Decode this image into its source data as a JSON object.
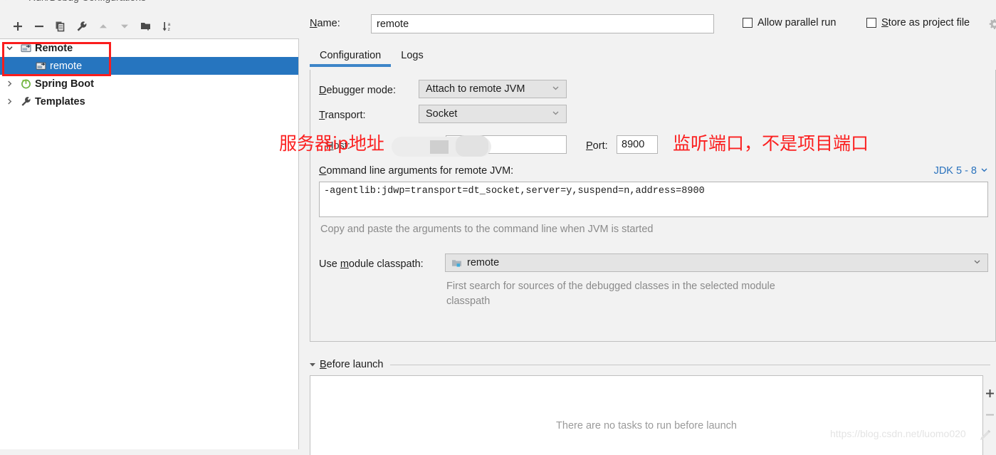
{
  "window": {
    "title_sliver": "Run/Debug Configurations"
  },
  "tree_toolbar": {
    "buttons": [
      {
        "name": "add-icon",
        "label": "Add New Configuration",
        "enabled": true
      },
      {
        "name": "remove-icon",
        "label": "Remove Configuration",
        "enabled": true
      },
      {
        "name": "copy-icon",
        "label": "Copy Configuration",
        "enabled": true
      },
      {
        "name": "wrench-icon",
        "label": "Edit Templates",
        "enabled": true
      },
      {
        "name": "arrow-up-icon",
        "label": "Move Up",
        "enabled": false
      },
      {
        "name": "arrow-down-icon",
        "label": "Move Down",
        "enabled": false
      },
      {
        "name": "new-folder-icon",
        "label": "Create New Folder",
        "enabled": true
      },
      {
        "name": "sort-alphabetically-icon",
        "label": "Sort Configurations",
        "enabled": true
      }
    ]
  },
  "tree": {
    "items": [
      {
        "label": "Remote",
        "level": 1,
        "expanded": true,
        "selected": false,
        "bold": true,
        "icon": "remote-config-icon"
      },
      {
        "label": "remote",
        "level": 2,
        "expanded": null,
        "selected": true,
        "bold": false,
        "icon": "remote-config-icon"
      },
      {
        "label": "Spring Boot",
        "level": 1,
        "expanded": false,
        "selected": false,
        "bold": true,
        "icon": "spring-boot-icon"
      },
      {
        "label": "Templates",
        "level": 1,
        "expanded": false,
        "selected": false,
        "bold": true,
        "icon": "wrench-icon"
      }
    ]
  },
  "header": {
    "name_label": "Name:",
    "name_value": "remote",
    "allow_parallel_run_label": "Allow parallel run",
    "allow_parallel_run_checked": false,
    "store_as_project_file_label": "Store as project file",
    "store_as_project_file_checked": false,
    "gear_icon": "gear-icon"
  },
  "tabs": [
    {
      "label": "Configuration",
      "active": true
    },
    {
      "label": "Logs",
      "active": false
    }
  ],
  "configuration": {
    "debugger_mode_label": "Debugger mode:",
    "debugger_mode_value": "Attach to remote JVM",
    "transport_label": "Transport:",
    "transport_value": "Socket",
    "host_label": "Host:",
    "host_value": "",
    "port_label": "Port:",
    "port_value": "8900",
    "jvm_args_label": "Command line arguments for remote JVM:",
    "jdk_version_link": "JDK 5 - 8",
    "jvm_args_value": "-agentlib:jdwp=transport=dt_socket,server=y,suspend=n,address=8900",
    "jvm_args_hint": "Copy and paste the arguments to the command line when JVM is started",
    "module_classpath_label": "Use module classpath:",
    "module_classpath_value": "remote",
    "module_classpath_hint": "First search for sources of the debugged classes in the selected module classpath"
  },
  "before_launch": {
    "title": "Before launch",
    "expanded": true,
    "empty_text": "There are no tasks to run before launch",
    "add_button": "+",
    "remove_button": "−"
  },
  "annotations": [
    {
      "name": "host-annotation",
      "text": "服务器ip地址",
      "color": "#fb2020"
    },
    {
      "name": "port-annotation",
      "text": "监听端口，不是项目端口",
      "color": "#fb2020"
    }
  ],
  "watermark": {
    "text": "https://blog.csdn.net/luomo020"
  },
  "colors": {
    "selection_blue": "#2675bf",
    "tab_underline": "#3d85c8",
    "link_blue": "#2a72bd",
    "annotation_red": "#fb2020",
    "panel_bg": "#f2f2f2"
  }
}
